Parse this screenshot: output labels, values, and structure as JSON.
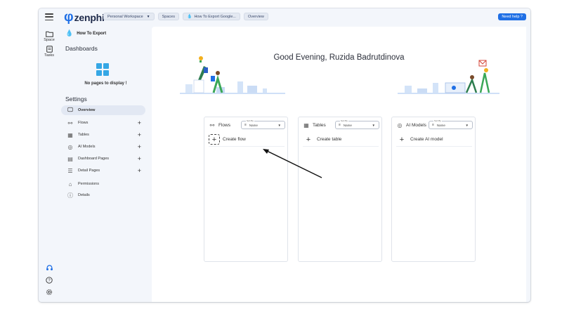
{
  "app": {
    "logo_symbol": "φ",
    "logo_text": "zenphi"
  },
  "breadcrumbs": [
    {
      "label": "Personal Workspace",
      "has_caret": true
    },
    {
      "label": "Spaces"
    },
    {
      "label": "How To Export Google...",
      "icon": "space-icon"
    },
    {
      "label": "Overview"
    }
  ],
  "help_label": "Need help ?",
  "rail": {
    "space_label": "Space",
    "tasks_label": "Tasks"
  },
  "sidebar": {
    "space_name": "How To Export",
    "dashboards_title": "Dashboards",
    "empty_text": "No pages to display !",
    "settings_title": "Settings",
    "items": [
      {
        "label": "Overview",
        "icon": "monitor-icon",
        "active": true,
        "plus": false
      },
      {
        "label": "Flows",
        "icon": "flows-icon",
        "active": false,
        "plus": true
      },
      {
        "label": "Tables",
        "icon": "tables-icon",
        "active": false,
        "plus": true
      },
      {
        "label": "AI Models",
        "icon": "ai-models-icon",
        "active": false,
        "plus": true
      },
      {
        "label": "Dashboard Pages",
        "icon": "dashboard-pages-icon",
        "active": false,
        "plus": true
      },
      {
        "label": "Detail Pages",
        "icon": "detail-pages-icon",
        "active": false,
        "plus": true
      },
      {
        "label": "Permissions",
        "icon": "permissions-icon",
        "active": false,
        "plus": false
      },
      {
        "label": "Details",
        "icon": "info-icon",
        "active": false,
        "plus": false
      }
    ]
  },
  "main": {
    "greeting": "Good Evening, Ruzida Badrutdinova",
    "cards": [
      {
        "title": "Flows",
        "sort_label": "Sort By",
        "sort_value": "Name",
        "create_label": "Create flow"
      },
      {
        "title": "Tables",
        "sort_label": "Sort By",
        "sort_value": "Name",
        "create_label": "Create table"
      },
      {
        "title": "AI Models",
        "sort_label": "Sort By",
        "sort_value": "Name",
        "create_label": "Create AI model"
      }
    ]
  },
  "colors": {
    "brand": "#1f6fe5",
    "accent_green": "#3aa757",
    "empty_icon": "#35a7e5"
  }
}
